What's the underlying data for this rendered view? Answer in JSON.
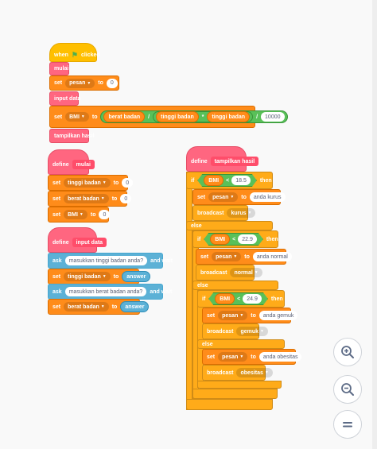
{
  "script1": {
    "hat": {
      "when": "when",
      "clicked": "clicked"
    },
    "call_mulai": "mulai",
    "set_pesan": {
      "set": "set",
      "var": "pesan",
      "to": "to",
      "value": "0"
    },
    "call_input": "input data",
    "set_bmi": {
      "set": "set",
      "var": "BMI",
      "to": "to",
      "a": "berat badan",
      "div1": "/",
      "b": "tinggi badan",
      "mul": "*",
      "c": "tinggi badan",
      "div2": "/",
      "d": "10000"
    },
    "call_tampilkan": "tampilkan hasil"
  },
  "script2": {
    "define": "define",
    "name": "mulai",
    "rows": [
      {
        "set": "set",
        "var": "tinggi badan",
        "to": "to",
        "value": "0"
      },
      {
        "set": "set",
        "var": "berat badan",
        "to": "to",
        "value": "0"
      },
      {
        "set": "set",
        "var": "BMI",
        "to": "to",
        "value": "0"
      }
    ]
  },
  "script3": {
    "define": "define",
    "name": "input data",
    "ask1": {
      "ask": "ask",
      "question": "masukkan tinggi badan anda?",
      "wait": "and wait"
    },
    "set1": {
      "set": "set",
      "var": "tinggi badan",
      "to": "to",
      "value": "answer"
    },
    "ask2": {
      "ask": "ask",
      "question": "masukkan berat badan anda?",
      "wait": "and wait"
    },
    "set2": {
      "set": "set",
      "var": "berat badan",
      "to": "to",
      "value": "answer"
    }
  },
  "script4": {
    "define": "define",
    "name": "tampilkan hasil",
    "if_kw": "if",
    "then_kw": "then",
    "else_kw": "else",
    "lt": "<",
    "cond1": {
      "var": "BMI",
      "value": "18.5"
    },
    "set_kurus": {
      "set": "set",
      "var": "pesan",
      "to": "to",
      "value": "anda kurus"
    },
    "bc_kurus": {
      "broadcast": "broadcast",
      "msg": "kurus"
    },
    "cond2": {
      "var": "BMI",
      "value": "22.9"
    },
    "set_normal": {
      "set": "set",
      "var": "pesan",
      "to": "to",
      "value": "anda normal"
    },
    "bc_normal": {
      "broadcast": "broadcast",
      "msg": "normal"
    },
    "cond3": {
      "var": "BMI",
      "value": "24.9"
    },
    "set_gemuk": {
      "set": "set",
      "var": "pesan",
      "to": "to",
      "value": "anda gemuk"
    },
    "bc_gemuk": {
      "broadcast": "broadcast",
      "msg": "gemuk"
    },
    "set_obesitas": {
      "set": "set",
      "var": "pesan",
      "to": "to",
      "value": "anda obesitas"
    },
    "bc_obesitas": {
      "broadcast": "broadcast",
      "msg": "obesitas"
    }
  },
  "zoom": {
    "in_icon": "zoom-in-icon",
    "out_icon": "zoom-out-icon",
    "reset_icon": "zoom-reset-icon"
  },
  "colors": {
    "events": "#ffbf00",
    "variables": "#ff8c1a",
    "myblocks": "#ff6680",
    "sensing": "#5cb1d6",
    "operators": "#59c059",
    "control": "#ffab19"
  }
}
